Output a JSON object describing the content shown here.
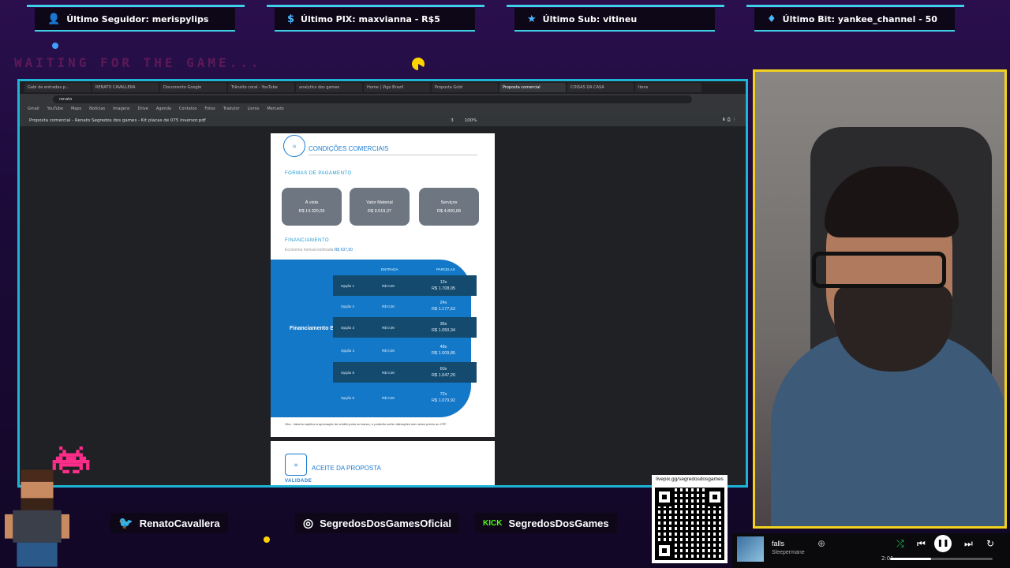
{
  "topbar": {
    "follower": "Último Seguidor: merispylips",
    "pix": "Último PIX: maxvianna - R$5",
    "sub": "Último Sub: vitineu",
    "bit": "Último Bit: yankee_channel - 50"
  },
  "waiting_text": "WAITING FOR THE GAME...",
  "browser": {
    "tabs": [
      "Gabi de entradas p...",
      "RENATO CAVALLERA",
      "Documento Google",
      "Trânsito coral - YouTube",
      "analytics dos games",
      "Home | Vigo Brazil",
      "Proposta Gold",
      "Proposta comercial",
      "COISAS DA CASA",
      "Itens"
    ],
    "address": "renato",
    "bookmarks": [
      "Gmail",
      "YouTube",
      "Maps",
      "Notícias",
      "Imagens",
      "Drive",
      "Agenda",
      "Contatos",
      "Fotos",
      "Tradutor",
      "Livros",
      "Mercado"
    ],
    "pdf_title": "Proposta comercial - Renato Segredos dos games - Kit placas de 075 inversor.pdf",
    "page_num": "3",
    "zoom": "100%"
  },
  "pdf": {
    "section1_title": "CONDIÇÕES COMERCIAIS",
    "payment_heading": "FORMAS DE PAGAMENTO",
    "payments": [
      {
        "label": "À vista",
        "value": "R$ 14.320,05"
      },
      {
        "label": "Valor Material",
        "value": "R$ 9.519,37"
      },
      {
        "label": "Serviços",
        "value": "R$ 4.800,68"
      }
    ],
    "financing_heading": "FINANCIAMENTO",
    "financing_note": "Economia mensal estimada",
    "financing_note_value": "R$ 637,50",
    "col_entrada": "ENTRADA",
    "col_parcela": "PARCELAS",
    "financing_label": "Financiamento BV",
    "rows": [
      {
        "op": "Opção 1",
        "entrada": "R$ 0,00",
        "term": "12x",
        "parcela": "R$ 1.708,05"
      },
      {
        "op": "Opção 2",
        "entrada": "R$ 0,00",
        "term": "24x",
        "parcela": "R$ 1.177,63"
      },
      {
        "op": "Opção 3",
        "entrada": "R$ 0,00",
        "term": "36x",
        "parcela": "R$ 1.050,34"
      },
      {
        "op": "Opção 4",
        "entrada": "R$ 0,00",
        "term": "48x",
        "parcela": "R$ 1.009,85"
      },
      {
        "op": "Opção 5",
        "entrada": "R$ 0,00",
        "term": "60x",
        "parcela": "R$ 1.047,20"
      },
      {
        "op": "Opção 6",
        "entrada": "R$ 0,00",
        "term": "72x",
        "parcela": "R$ 1.079,92"
      }
    ],
    "footnote": "Obs.: Valores sujeitos a aprovação de crédito junto ao banco, e poderão sofrer alterações sem aviso prévio ao CPF.",
    "section2_title": "ACEITE DA PROPOSTA",
    "validity": "VALIDADE"
  },
  "social": {
    "twitter": "RenatoCavallera",
    "instagram": "SegredosDosGamesOficial",
    "kick_tag": "KICK",
    "kick": "SegredosDosGames"
  },
  "qr_label": "livepix.gg/segredosdosgames",
  "player": {
    "track": "falls",
    "artist": "Sleepermane",
    "time": "2:01",
    "progress": 0.4
  },
  "colors": {
    "accent_cyan": "#3fd0e8",
    "cam_border": "#f2d21c",
    "pdf_blue": "#1478c8",
    "bg": "#1a0b33"
  }
}
